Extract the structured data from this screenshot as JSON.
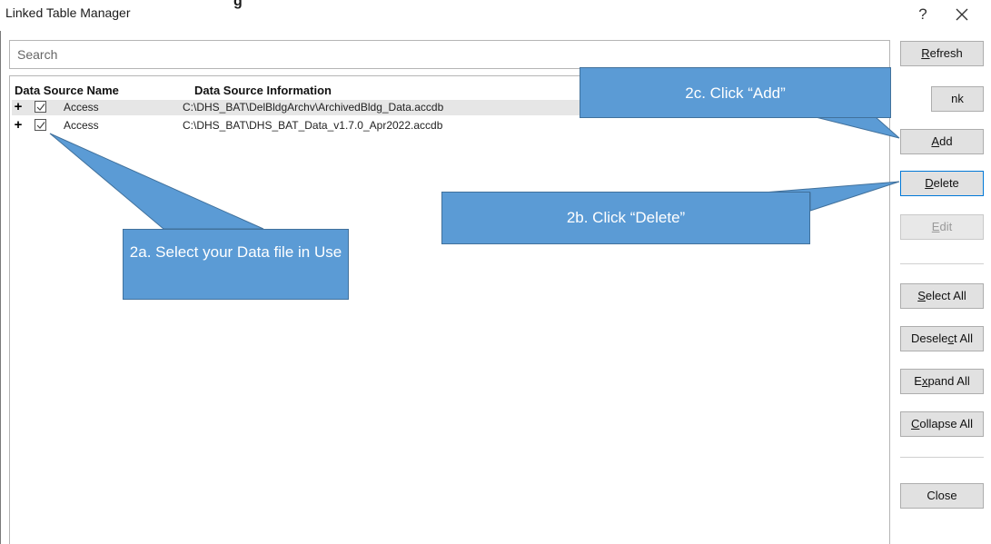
{
  "window": {
    "title": "Linked Table Manager",
    "title_cut_text": "g",
    "help_label": "?"
  },
  "search": {
    "placeholder": "Search"
  },
  "table": {
    "columns": [
      "Data Source Name",
      "Data Source Information"
    ],
    "rows": [
      {
        "expand": "+",
        "checked": true,
        "name": "Access",
        "info": "C:\\DHS_BAT\\DelBldgArchv\\ArchivedBldg_Data.accdb",
        "selected": true
      },
      {
        "expand": "+",
        "checked": true,
        "name": "Access",
        "info": "C:\\DHS_BAT\\DHS_BAT_Data_v1.7.0_Apr2022.accdb",
        "selected": false
      }
    ]
  },
  "buttons": {
    "refresh": {
      "pre": "",
      "ul": "R",
      "post": "efresh"
    },
    "relink": {
      "pre": "",
      "ul": "",
      "post": "nk"
    },
    "add": {
      "pre": "",
      "ul": "A",
      "post": "dd"
    },
    "delete": {
      "pre": "",
      "ul": "D",
      "post": "elete"
    },
    "edit": {
      "pre": "",
      "ul": "E",
      "post": "dit"
    },
    "select_all": {
      "pre": "",
      "ul": "S",
      "post": "elect All"
    },
    "deselect_all": {
      "pre": "Desele",
      "ul": "c",
      "post": "t All"
    },
    "expand_all": {
      "pre": "E",
      "ul": "x",
      "post": "pand All"
    },
    "collapse_all": {
      "pre": "",
      "ul": "C",
      "post": "ollapse All"
    },
    "close": {
      "pre": "",
      "ul": "",
      "post": "Close"
    }
  },
  "callouts": {
    "select": "2a. Select your Data file in Use",
    "delete": "2b. Click “Delete”",
    "add": "2c. Click “Add”"
  },
  "colors": {
    "callout_fill": "#5b9bd5",
    "callout_border": "#41719c",
    "focus_border": "#0078d7",
    "selected_row": "#e6e6e6"
  }
}
